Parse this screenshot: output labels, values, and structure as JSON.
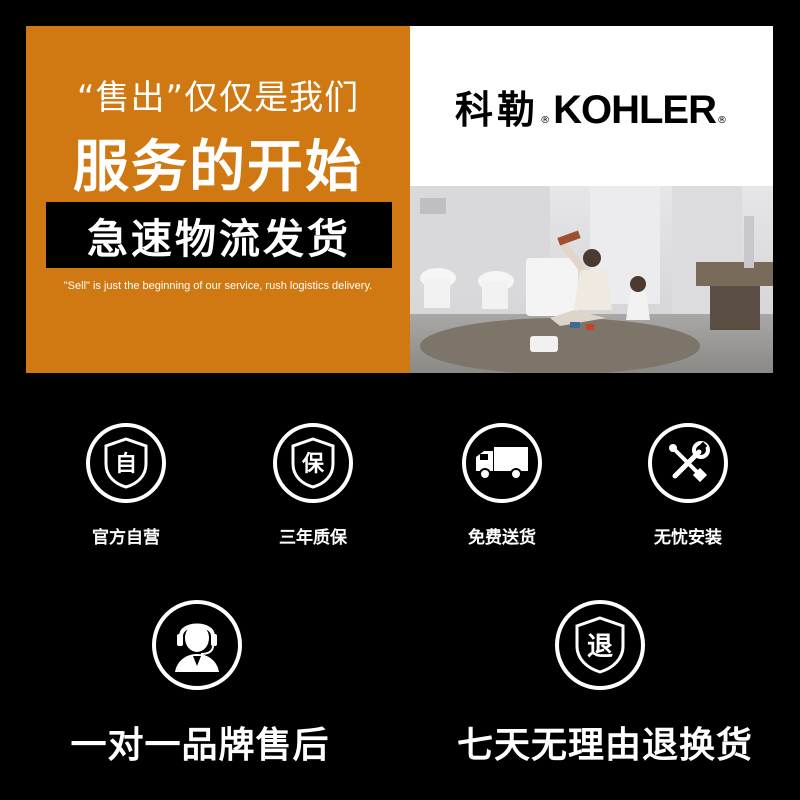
{
  "banner": {
    "slogan_line1": "“售出”仅仅是我们",
    "slogan_line2": "服务的开始",
    "slogan_line3": "急速物流发货",
    "slogan_english": "\"Sell\" is just the beginning of our service, rush logistics delivery.",
    "logo_chinese": "科勒",
    "logo_registered": "®",
    "logo_english": "KOHLER",
    "accent_color": "#d07812"
  },
  "features": [
    {
      "icon_char": "自",
      "label": "官方自营",
      "icon": "shield-zi-icon"
    },
    {
      "icon_char": "保",
      "label": "三年质保",
      "icon": "shield-bao-icon"
    },
    {
      "icon_char": "",
      "label": "免费送货",
      "icon": "delivery-truck-icon"
    },
    {
      "icon_char": "",
      "label": "无忧安装",
      "icon": "wrench-screwdriver-icon"
    }
  ],
  "services": [
    {
      "icon_char": "",
      "label": "一对一品牌售后",
      "icon": "customer-service-agent-icon"
    },
    {
      "icon_char": "退",
      "label": "七天无理由退换货",
      "icon": "shield-tui-icon"
    }
  ]
}
